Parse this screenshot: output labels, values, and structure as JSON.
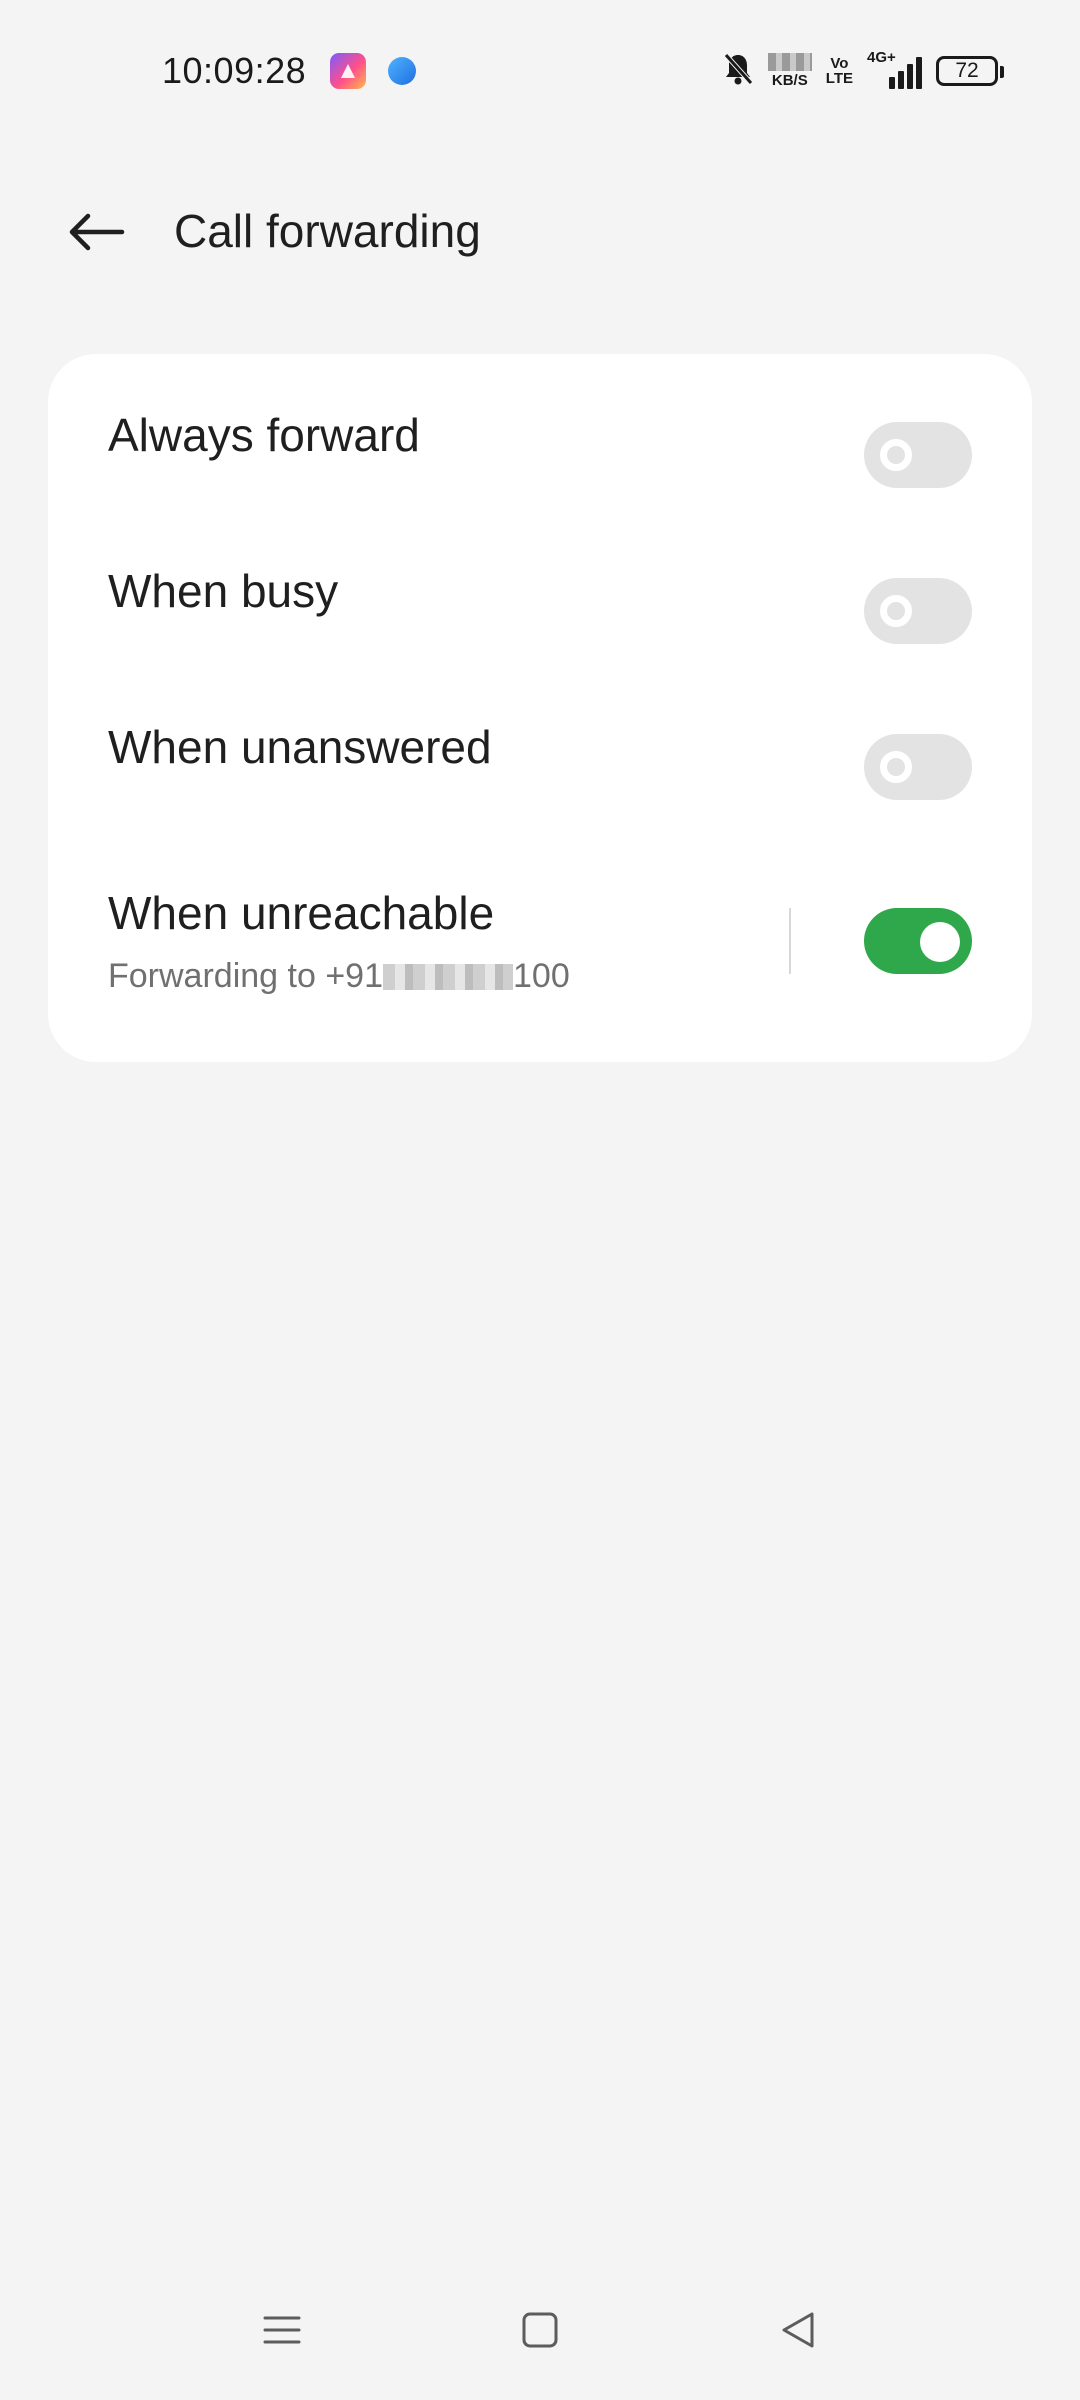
{
  "status_bar": {
    "time": "10:09:28",
    "speed_unit": "KB/S",
    "volte_top": "Vo",
    "volte_bottom": "LTE",
    "network": "4G+",
    "battery": "72",
    "icons": [
      "app-launcher-icon",
      "browser-icon",
      "mute-bell-icon",
      "signal-icon",
      "battery-icon"
    ]
  },
  "header": {
    "title": "Call forwarding",
    "back_icon": "arrow-left-icon"
  },
  "options": [
    {
      "label": "Always forward",
      "enabled": false
    },
    {
      "label": "When busy",
      "enabled": false
    },
    {
      "label": "When unanswered",
      "enabled": false
    },
    {
      "label": "When unreachable",
      "enabled": true,
      "subtitle_prefix": "Forwarding to +91",
      "subtitle_suffix": "100"
    }
  ],
  "colors": {
    "toggle_on": "#2ea84a",
    "toggle_off": "#e3e3e3",
    "background": "#f4f4f4",
    "card": "#ffffff"
  },
  "nav_bar": {
    "icons": [
      "menu-icon",
      "home-square-icon",
      "back-triangle-icon"
    ]
  }
}
